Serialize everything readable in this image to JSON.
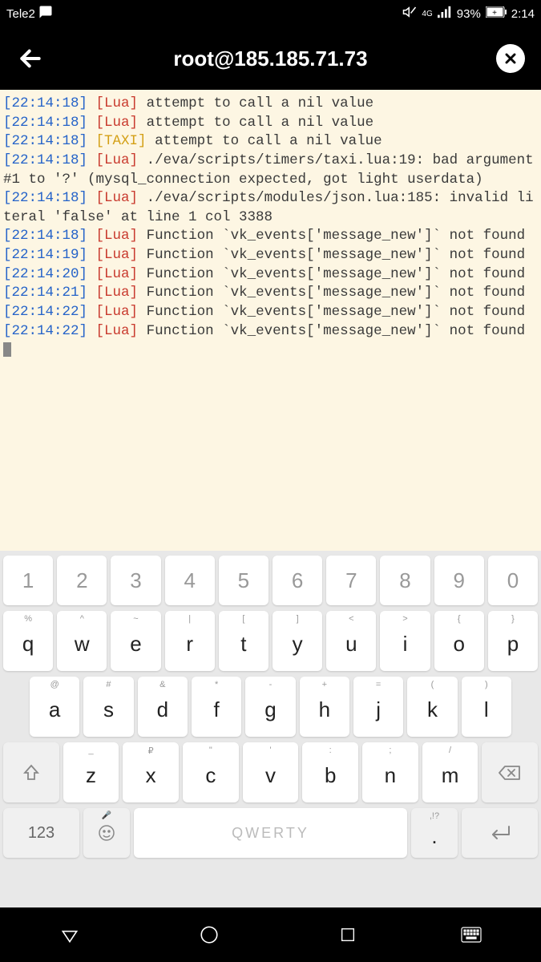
{
  "status": {
    "carrier": "Tele2",
    "network": "4G",
    "battery": "93%",
    "time": "2:14"
  },
  "header": {
    "title": "root@185.185.71.73"
  },
  "terminal": {
    "lines": [
      {
        "ts": "[22:14:18]",
        "tag": "[Lua]",
        "tagType": "lua",
        "msg": "attempt to call a nil value"
      },
      {
        "ts": "[22:14:18]",
        "tag": "[Lua]",
        "tagType": "lua",
        "msg": "attempt to call a nil value"
      },
      {
        "ts": "[22:14:18]",
        "tag": "[TAXI]",
        "tagType": "taxi",
        "msg": "attempt to call a nil value"
      },
      {
        "ts": "[22:14:18]",
        "tag": "[Lua]",
        "tagType": "lua",
        "msg": "./eva/scripts/timers/taxi.lua:19: bad argument #1 to '?' (mysql_connection expected, got light userdata)"
      },
      {
        "ts": "[22:14:18]",
        "tag": "[Lua]",
        "tagType": "lua",
        "msg": "./eva/scripts/modules/json.lua:185: invalid literal 'false' at line 1 col 3388"
      },
      {
        "ts": "[22:14:18]",
        "tag": "[Lua]",
        "tagType": "lua",
        "msg": "Function `vk_events['message_new']` not found"
      },
      {
        "ts": "[22:14:19]",
        "tag": "[Lua]",
        "tagType": "lua",
        "msg": "Function `vk_events['message_new']` not found"
      },
      {
        "ts": "[22:14:20]",
        "tag": "[Lua]",
        "tagType": "lua",
        "msg": "Function `vk_events['message_new']` not found"
      },
      {
        "ts": "[22:14:21]",
        "tag": "[Lua]",
        "tagType": "lua",
        "msg": "Function `vk_events['message_new']` not found"
      },
      {
        "ts": "[22:14:22]",
        "tag": "[Lua]",
        "tagType": "lua",
        "msg": "Function `vk_events['message_new']` not found"
      },
      {
        "ts": "[22:14:22]",
        "tag": "[Lua]",
        "tagType": "lua",
        "msg": "Function `vk_events['message_new']` not found"
      }
    ]
  },
  "keyboard": {
    "row1": [
      "1",
      "2",
      "3",
      "4",
      "5",
      "6",
      "7",
      "8",
      "9",
      "0"
    ],
    "row2": [
      {
        "m": "q",
        "s": "%"
      },
      {
        "m": "w",
        "s": "^"
      },
      {
        "m": "e",
        "s": "~"
      },
      {
        "m": "r",
        "s": "|"
      },
      {
        "m": "t",
        "s": "["
      },
      {
        "m": "y",
        "s": "]"
      },
      {
        "m": "u",
        "s": "<"
      },
      {
        "m": "i",
        "s": ">"
      },
      {
        "m": "o",
        "s": "{"
      },
      {
        "m": "p",
        "s": "}"
      }
    ],
    "row3": [
      {
        "m": "a",
        "s": "@"
      },
      {
        "m": "s",
        "s": "#"
      },
      {
        "m": "d",
        "s": "&"
      },
      {
        "m": "f",
        "s": "*"
      },
      {
        "m": "g",
        "s": "-"
      },
      {
        "m": "h",
        "s": "+"
      },
      {
        "m": "j",
        "s": "="
      },
      {
        "m": "k",
        "s": "("
      },
      {
        "m": "l",
        "s": ")"
      }
    ],
    "row4": [
      {
        "m": "z",
        "s": "_"
      },
      {
        "m": "x",
        "s": "₽"
      },
      {
        "m": "c",
        "s": "\""
      },
      {
        "m": "v",
        "s": "'"
      },
      {
        "m": "b",
        "s": ":"
      },
      {
        "m": "n",
        "s": ";"
      },
      {
        "m": "m",
        "s": "/"
      }
    ],
    "symKey": "123",
    "spaceLabel": "QWERTY",
    "punctKey": ".",
    "punctSec": ",!?"
  }
}
